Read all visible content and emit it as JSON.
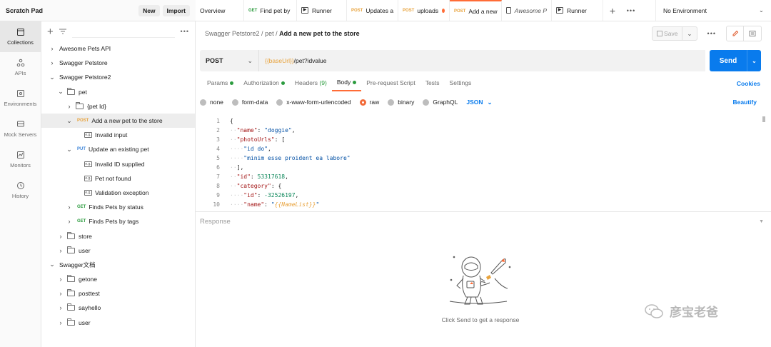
{
  "app": {
    "workspace": "Scratch Pad",
    "new_label": "New",
    "import_label": "Import"
  },
  "rail": [
    {
      "label": "Collections",
      "icon": "collections-icon",
      "active": true
    },
    {
      "label": "APIs",
      "icon": "apis-icon"
    },
    {
      "label": "Environments",
      "icon": "environments-icon"
    },
    {
      "label": "Mock Servers",
      "icon": "mock-servers-icon"
    },
    {
      "label": "Monitors",
      "icon": "monitors-icon"
    },
    {
      "label": "History",
      "icon": "history-icon"
    }
  ],
  "tree": {
    "more": "•••",
    "items": [
      {
        "label": "Awesome Pets API",
        "kind": "collection",
        "chev": "›"
      },
      {
        "label": "Swagger Petstore",
        "kind": "collection",
        "chev": "›"
      },
      {
        "label": "Swagger Petstore2",
        "kind": "collection",
        "chev": "⌄"
      },
      {
        "label": "pet",
        "kind": "folder",
        "chev": "⌄"
      },
      {
        "label": "{pet Id}",
        "kind": "folder",
        "chev": "›"
      },
      {
        "label": "Add a new pet to the store",
        "kind": "request",
        "method": "POST",
        "chev": "⌄",
        "selected": true
      },
      {
        "label": "Invalid input",
        "kind": "example",
        "badge": "e.g."
      },
      {
        "label": "Update an existing pet",
        "kind": "request",
        "method": "PUT",
        "chev": "⌄"
      },
      {
        "label": "Invalid ID supplied",
        "kind": "example",
        "badge": "e.g."
      },
      {
        "label": "Pet not found",
        "kind": "example",
        "badge": "e.g."
      },
      {
        "label": "Validation exception",
        "kind": "example",
        "badge": "e.g."
      },
      {
        "label": "Finds Pets by status",
        "kind": "request",
        "method": "GET",
        "chev": "›"
      },
      {
        "label": "Finds Pets by tags",
        "kind": "request",
        "method": "GET",
        "chev": "›"
      },
      {
        "label": "store",
        "kind": "folder",
        "chev": "›"
      },
      {
        "label": "user",
        "kind": "folder",
        "chev": "›"
      },
      {
        "label": "Swagger文档",
        "kind": "collection",
        "chev": "⌄"
      },
      {
        "label": "getone",
        "kind": "folder",
        "chev": "›"
      },
      {
        "label": "posttest",
        "kind": "folder",
        "chev": "›"
      },
      {
        "label": "sayhello",
        "kind": "folder",
        "chev": "›"
      },
      {
        "label": "user",
        "kind": "folder",
        "chev": "›"
      }
    ]
  },
  "tabs": [
    {
      "label": "Overview"
    },
    {
      "label": "Find pet by",
      "method": "GET"
    },
    {
      "label": "Runner",
      "icon": "runner-icon"
    },
    {
      "label": "Updates a",
      "method": "POST"
    },
    {
      "label": "uploads",
      "method": "POST",
      "dot": true
    },
    {
      "label": "Add a new",
      "method": "POST",
      "active": true
    },
    {
      "label": "Awesome P",
      "icon": "doc-icon",
      "italic": true
    },
    {
      "label": "Runner",
      "icon": "runner-icon"
    }
  ],
  "tabs_add": "+",
  "tabs_more": "•••",
  "environment": "No Environment",
  "breadcrumb": {
    "a": "Swagger Petstore2",
    "sep": " / ",
    "b": "pet",
    "cur": "Add a new pet to the store"
  },
  "save_label": "Save",
  "request": {
    "method": "POST",
    "url_var": "{{baseUrl}}",
    "url_rest": "/pet?idvalue",
    "send_label": "Send"
  },
  "req_tabs": [
    {
      "label": "Params",
      "dot": true
    },
    {
      "label": "Authorization",
      "dot": true
    },
    {
      "label": "Headers",
      "count": "(9)"
    },
    {
      "label": "Body",
      "dot": true,
      "active": true
    },
    {
      "label": "Pre-request Script"
    },
    {
      "label": "Tests"
    },
    {
      "label": "Settings"
    }
  ],
  "cookies_label": "Cookies",
  "body_types": [
    {
      "label": "none"
    },
    {
      "label": "form-data"
    },
    {
      "label": "x-www-form-urlencoded"
    },
    {
      "label": "raw",
      "selected": true
    },
    {
      "label": "binary"
    },
    {
      "label": "GraphQL"
    }
  ],
  "raw_format": "JSON",
  "beautify_label": "Beautify",
  "code_lines": [
    {
      "n": "1",
      "html": "{"
    },
    {
      "n": "2",
      "html": "<span class=\"ws\">··</span><span class=\"k\">\"name\"</span>: <span class=\"s\">\"doggie\"</span>,"
    },
    {
      "n": "3",
      "html": "<span class=\"ws\">··</span><span class=\"k\">\"photoUrls\"</span>: ["
    },
    {
      "n": "4",
      "html": "<span class=\"ws\">····</span><span class=\"s\">\"id do\"</span>,"
    },
    {
      "n": "5",
      "html": "<span class=\"ws\">····</span><span class=\"s\">\"minim esse proident ea labore\"</span>"
    },
    {
      "n": "6",
      "html": "<span class=\"ws\">··</span>],"
    },
    {
      "n": "7",
      "html": "<span class=\"ws\">··</span><span class=\"k\">\"id\"</span>: <span class=\"num\">53317618</span>,"
    },
    {
      "n": "8",
      "html": "<span class=\"ws\">··</span><span class=\"k\">\"category\"</span>: {"
    },
    {
      "n": "9",
      "html": "<span class=\"ws\">····</span><span class=\"k\">\"id\"</span>: <span class=\"num\">-32526197</span>,"
    },
    {
      "n": "10",
      "html": "<span class=\"ws\">····</span><span class=\"k\">\"name\"</span>: <span class=\"s\">\"</span><span class=\"tv\">{{NameList}}</span><span class=\"s\">\"</span>"
    }
  ],
  "response_label": "Response",
  "empty_response": "Click Send to get a response",
  "watermark_text": "彦宝老爸"
}
